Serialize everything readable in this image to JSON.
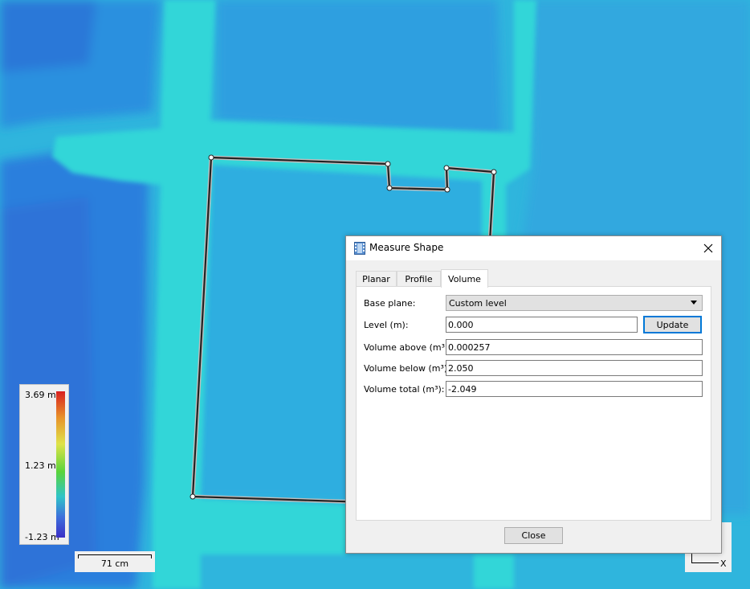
{
  "legend": {
    "max_label": "3.69 m",
    "mid_label": "1.23 m",
    "min_label": "-1.23 m"
  },
  "scale_bar": {
    "label": "71 cm"
  },
  "axis": {
    "x_label": "X"
  },
  "colors": {
    "accent": "#0078d7",
    "shape_outline": "#000000",
    "map_bg": "#2fb5dd"
  },
  "dialog": {
    "title": "Measure Shape",
    "close_icon": "close-icon",
    "tabs": [
      {
        "label": "Planar",
        "active": false
      },
      {
        "label": "Profile",
        "active": false
      },
      {
        "label": "Volume",
        "active": true
      }
    ],
    "base_plane": {
      "label": "Base plane:",
      "value": "Custom level"
    },
    "level": {
      "label": "Level (m):",
      "value": "0.000",
      "button": "Update"
    },
    "volume_above": {
      "label": "Volume above (m³):",
      "value": "0.000257"
    },
    "volume_below": {
      "label": "Volume below (m³):",
      "value": "2.050"
    },
    "volume_total": {
      "label": "Volume total (m³):",
      "value": "-2.049"
    },
    "close_button": "Close"
  }
}
